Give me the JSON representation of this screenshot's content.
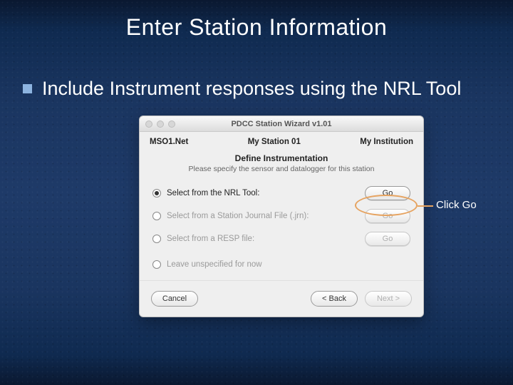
{
  "slide": {
    "title": "Enter Station Information",
    "bullet": "Include Instrument responses using the NRL Tool"
  },
  "callout": {
    "label": "Click Go"
  },
  "window": {
    "title": "PDCC Station Wizard v1.01",
    "header": {
      "left": "MSO1.Net",
      "center": "My Station 01",
      "right": "My Institution"
    },
    "section": {
      "heading": "Define Instrumentation",
      "sub": "Please specify the sensor and datalogger for this station"
    },
    "options": [
      {
        "label": "Select from the NRL Tool:",
        "button": "Go",
        "selected": true,
        "enabled": true
      },
      {
        "label": "Select from a Station Journal File (.jrn):",
        "button": "Go",
        "selected": false,
        "enabled": false
      },
      {
        "label": "Select from a RESP file:",
        "button": "Go",
        "selected": false,
        "enabled": false
      },
      {
        "label": "Leave unspecified for now",
        "button": "",
        "selected": false,
        "enabled": false
      }
    ],
    "nav": {
      "cancel": "Cancel",
      "back": "< Back",
      "next": "Next >"
    }
  }
}
